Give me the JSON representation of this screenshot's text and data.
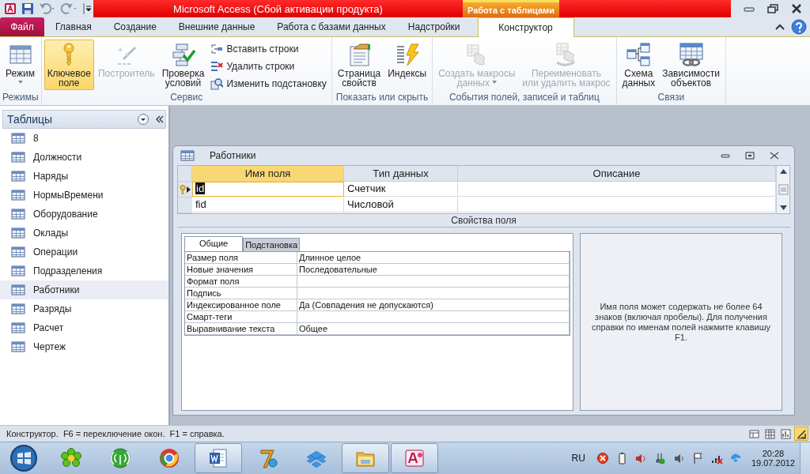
{
  "title_bar": {
    "title": "Microsoft Access (Сбой активации продукта)",
    "context_tab": "Работа с таблицами"
  },
  "ribbon_tabs": [
    {
      "label": "Файл",
      "kind": "file",
      "selected": false
    },
    {
      "label": "Главная",
      "kind": "tab",
      "selected": false
    },
    {
      "label": "Создание",
      "kind": "tab",
      "selected": false
    },
    {
      "label": "Внешние данные",
      "kind": "tab",
      "selected": false
    },
    {
      "label": "Работа с базами данных",
      "kind": "tab",
      "selected": false
    },
    {
      "label": "Надстройки",
      "kind": "tab",
      "selected": false
    },
    {
      "label": "Конструктор",
      "kind": "tab",
      "selected": true
    }
  ],
  "ribbon_groups": [
    {
      "label": "Режимы",
      "buttons": [
        {
          "label": "Режим",
          "dropdown": true,
          "disabled": false,
          "selected": false
        }
      ]
    },
    {
      "label": "Сервис",
      "buttons": [
        {
          "label": "Ключевое\nполе",
          "dropdown": false,
          "disabled": false,
          "selected": true
        },
        {
          "label": "Построитель",
          "dropdown": false,
          "disabled": true,
          "selected": false
        },
        {
          "label": "Проверка\nусловий",
          "dropdown": false,
          "disabled": false,
          "selected": false
        }
      ],
      "small_buttons": [
        {
          "label": "Вставить строки"
        },
        {
          "label": "Удалить строки"
        },
        {
          "label": "Изменить подстановку"
        }
      ]
    },
    {
      "label": "Показать или скрыть",
      "buttons": [
        {
          "label": "Страница\nсвойств",
          "dropdown": false,
          "disabled": false,
          "selected": false
        },
        {
          "label": "Индексы",
          "dropdown": false,
          "disabled": false,
          "selected": false
        }
      ]
    },
    {
      "label": "События полей, записей и таблиц",
      "buttons": [
        {
          "label": "Создать макросы\nданных",
          "dropdown": true,
          "disabled": true,
          "selected": false
        },
        {
          "label": "Переименовать\nили удалить макрос",
          "dropdown": false,
          "disabled": true,
          "selected": false
        }
      ]
    },
    {
      "label": "Связи",
      "buttons": [
        {
          "label": "Схема\nданных",
          "dropdown": false,
          "disabled": false,
          "selected": false
        },
        {
          "label": "Зависимости\nобъектов",
          "dropdown": false,
          "disabled": false,
          "selected": false
        }
      ]
    }
  ],
  "navigation": {
    "header": "Таблицы",
    "items": [
      {
        "label": "8",
        "selected": false
      },
      {
        "label": "Должности",
        "selected": false
      },
      {
        "label": "Наряды",
        "selected": false
      },
      {
        "label": "НормыВремени",
        "selected": false
      },
      {
        "label": "Оборудование",
        "selected": false
      },
      {
        "label": "Оклады",
        "selected": false
      },
      {
        "label": "Операции",
        "selected": false
      },
      {
        "label": "Подразделения",
        "selected": false
      },
      {
        "label": "Работники",
        "selected": true
      },
      {
        "label": "Разряды",
        "selected": false
      },
      {
        "label": "Расчет",
        "selected": false
      },
      {
        "label": "Чертеж",
        "selected": false
      }
    ]
  },
  "designer": {
    "title": "Работники",
    "columns": [
      {
        "label": "Имя поля",
        "selected": true
      },
      {
        "label": "Тип данных",
        "selected": false
      },
      {
        "label": "Описание",
        "selected": false
      }
    ],
    "rows": [
      {
        "field_name": "id",
        "data_type": "Счетчик",
        "primary_key": true,
        "selected": true
      },
      {
        "field_name": "fid",
        "data_type": "Числовой",
        "primary_key": false,
        "selected": false
      }
    ],
    "properties_caption": "Свойства поля",
    "property_tabs": [
      {
        "label": "Общие",
        "selected": true
      },
      {
        "label": "Подстановка",
        "selected": false
      }
    ],
    "properties": [
      {
        "name": "Размер поля",
        "value": "Длинное целое"
      },
      {
        "name": "Новые значения",
        "value": "Последовательные"
      },
      {
        "name": "Формат поля"
      },
      {
        "name": "Подпись"
      },
      {
        "name": "Индексированное поле",
        "value": "Да (Совпадения не допускаются)"
      },
      {
        "name": "Смарт-теги"
      },
      {
        "name": "Выравнивание текста",
        "value": "Общее"
      }
    ],
    "help_text": "Имя поля может содержать не более 64 знаков (включая пробелы). Для получения справки по именам полей нажмите клавишу F1."
  },
  "status_bar": {
    "text": "Конструктор.  F6 = переключение окон.  F1 = справка.",
    "views": [
      {
        "selected": false
      },
      {
        "selected": false
      },
      {
        "selected": false
      },
      {
        "selected": true
      }
    ]
  },
  "taskbar": {
    "apps": [
      {
        "running": false
      },
      {
        "running": false
      },
      {
        "running": false
      },
      {
        "running": true
      },
      {
        "running": false
      },
      {
        "running": false
      },
      {
        "running": true
      },
      {
        "running": true
      }
    ],
    "language": "RU",
    "time": "20:28",
    "date": "19.07.2012"
  }
}
